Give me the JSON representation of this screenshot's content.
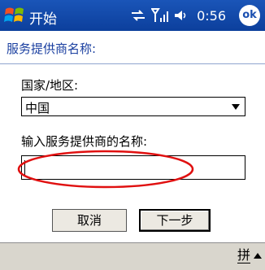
{
  "titlebar": {
    "start_label": "开始",
    "time": "0:56",
    "ok_label": "ok",
    "icons": [
      "windows-start-logo-icon",
      "sync-icon",
      "signal-icon",
      "volume-icon"
    ]
  },
  "subheader": {
    "title": "服务提供商名称:"
  },
  "form": {
    "country_label": "国家/地区:",
    "country_value": "中国",
    "name_label": "输入服务提供商的名称:",
    "name_value": ""
  },
  "buttons": {
    "cancel": "取消",
    "next": "下一步"
  },
  "bottombar": {
    "ime_label": "拼"
  },
  "colors": {
    "titlebar": "#1a4fb0",
    "accent_text": "#1a3fa0",
    "highlight": "#e01010",
    "bottombar": "#d9d6cd"
  }
}
